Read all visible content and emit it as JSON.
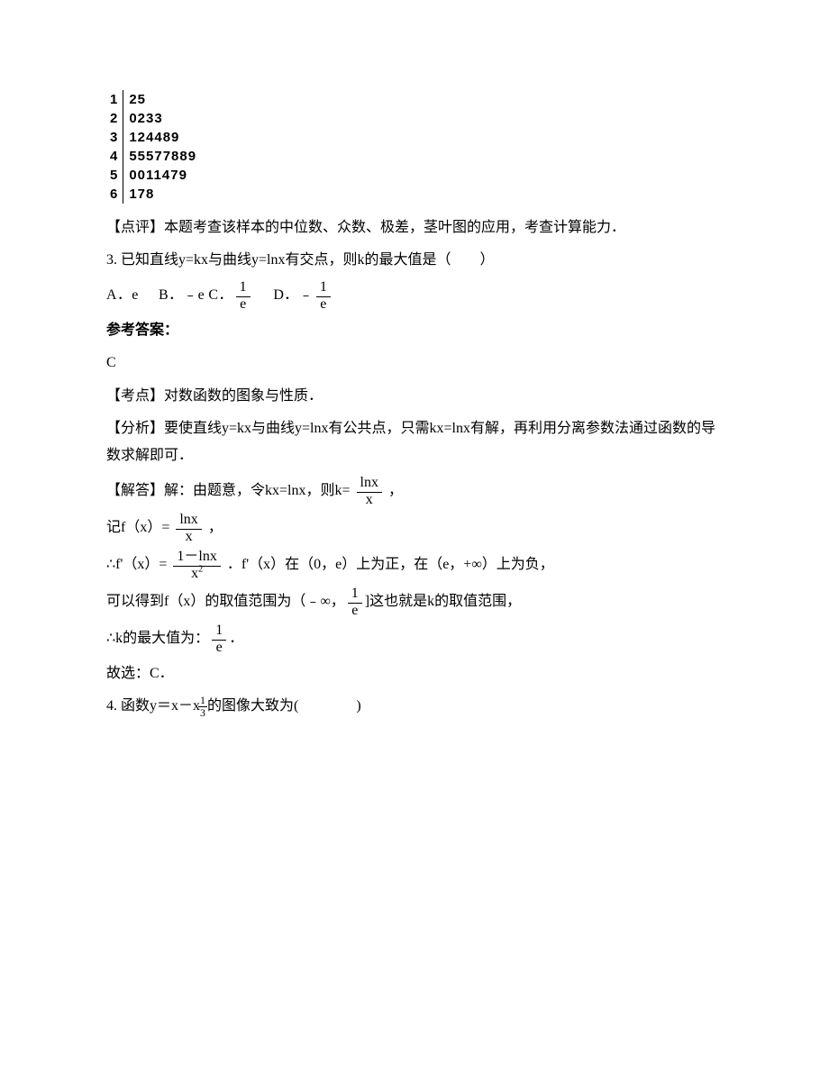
{
  "stem_leaf": {
    "rows": [
      {
        "stem": "1",
        "leaf": "25"
      },
      {
        "stem": "2",
        "leaf": "0233"
      },
      {
        "stem": "3",
        "leaf": "124489"
      },
      {
        "stem": "4",
        "leaf": "55577889"
      },
      {
        "stem": "5",
        "leaf": "0011479"
      },
      {
        "stem": "6",
        "leaf": "178"
      }
    ]
  },
  "dianping": "【点评】本题考查该样本的中位数、众数、极差，茎叶图的应用，考查计算能力．",
  "q3": {
    "text": "3. 已知直线y=kx与曲线y=lnx有交点，则k的最大值是（　　）",
    "optA": "A．e",
    "optB": "B．﹣e",
    "optClabel": "C．",
    "optC_num": "1",
    "optC_den": "e",
    "optDlabel": "D．",
    "optD_neg": "﹣",
    "optD_num": "1",
    "optD_den": "e"
  },
  "cankao": "参考答案：",
  "answer": "C",
  "kaodian": "【考点】对数函数的图象与性质．",
  "fenxi": "【分析】要使直线y=kx与曲线y=lnx有公共点，只需kx=lnx有解，再利用分离参数法通过函数的导数求解即可．",
  "jieda": {
    "l1a": "【解答】解：由题意，令kx=lnx，则k= ",
    "l1_num": "lnx",
    "l1_den": "x",
    "l1b": " ，",
    "l2a": "记f（x）= ",
    "l2_num": "lnx",
    "l2_den": "x",
    "l2b": " ，",
    "l3a": "∴f'（x）= ",
    "l3_num": "1－lnx",
    "l3_den": "x",
    "l3b": " ．f'（x）在（0，e）上为正，在（e，+∞）上为负，",
    "l4a": "可以得到f（x）的取值范围为（﹣∞，",
    "l4_num": "1",
    "l4_den": "e",
    "l4b": "]这也就是k的取值范围，",
    "l5a": "∴k的最大值为：",
    "l5_num": "1",
    "l5_den": "e",
    "l5b": "．",
    "l6": "故选：C．"
  },
  "q4": {
    "a": "4. 函数y＝x－x",
    "exp_num": "1",
    "exp_den": "3",
    "b": "的图像大致为(　　　　)"
  }
}
